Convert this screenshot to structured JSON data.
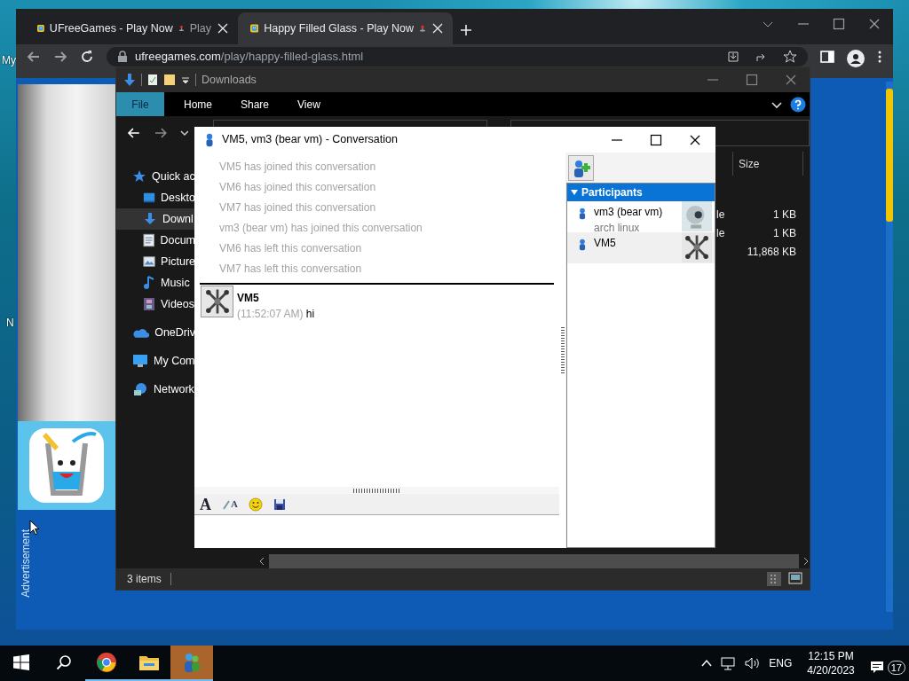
{
  "desktop": {
    "icon_labels": [
      "My",
      "N"
    ]
  },
  "browser": {
    "tabs": [
      {
        "label": "UFreeGames - Play Now",
        "label_tail": "Play",
        "selected": false
      },
      {
        "label": "Happy Filled Glass - Play Now",
        "selected": true
      }
    ],
    "address": {
      "domain": "ufreegames.com",
      "path": "/play/happy-filled-glass.html"
    },
    "page": {
      "ad_label": "Advertisement"
    }
  },
  "explorer": {
    "title": "Downloads",
    "ribbon_tabs": [
      {
        "label": "File",
        "selected": true
      },
      {
        "label": "Home",
        "selected": false
      },
      {
        "label": "Share",
        "selected": false
      },
      {
        "label": "View",
        "selected": false
      }
    ],
    "nav_items": [
      {
        "label": "Quick ac",
        "kind": "quick-access",
        "selected": false
      },
      {
        "label": "Deskto",
        "kind": "desktop",
        "selected": false
      },
      {
        "label": "Downl",
        "kind": "downloads",
        "selected": true
      },
      {
        "label": "Docum",
        "kind": "documents",
        "selected": false
      },
      {
        "label": "Picture",
        "kind": "pictures",
        "selected": false
      },
      {
        "label": "Music",
        "kind": "music",
        "selected": false
      },
      {
        "label": "Videos",
        "kind": "videos",
        "selected": false
      },
      {
        "label": "OneDriv",
        "kind": "onedrive",
        "selected": false
      },
      {
        "label": "My Com",
        "kind": "computer",
        "selected": false
      },
      {
        "label": "Network",
        "kind": "network",
        "selected": false
      }
    ],
    "columns": [
      "Size"
    ],
    "rows": [
      {
        "name": "le",
        "size": "1 KB"
      },
      {
        "name": "le",
        "size": "1 KB"
      },
      {
        "size": "11,868 KB"
      }
    ],
    "status": "3 items"
  },
  "conversation": {
    "title": "VM5, vm3 (bear vm) - Conversation",
    "events": [
      "VM5 has joined this conversation",
      "VM6 has joined this conversation",
      "VM7 has joined this conversation",
      "vm3 (bear vm) has joined this conversation",
      "VM6 has left this conversation",
      "VM7 has left this conversation"
    ],
    "messages": [
      {
        "sender": "VM5",
        "time": "(11:52:07 AM)",
        "text": "hi",
        "kind": "jacks"
      }
    ],
    "toolbar": [
      {
        "kind": "font",
        "label": "A"
      },
      {
        "kind": "color",
        "label": "A"
      },
      {
        "kind": "emoticon"
      },
      {
        "kind": "save"
      }
    ],
    "participants_header": "Participants",
    "participants": [
      {
        "name": "vm3 (bear vm)",
        "status": "arch linux",
        "kind": "webcam",
        "selected": false
      },
      {
        "name": "VM5",
        "kind": "jacks",
        "selected": true
      }
    ]
  },
  "taskbar": {
    "apps": [
      {
        "kind": "chrome",
        "running": true,
        "active": false
      },
      {
        "kind": "explorer",
        "running": true,
        "active": false
      },
      {
        "kind": "messenger",
        "running": true,
        "active": true
      }
    ],
    "language": "ENG",
    "time": "12:15 PM",
    "date": "4/20/2023",
    "notifications": "17"
  }
}
